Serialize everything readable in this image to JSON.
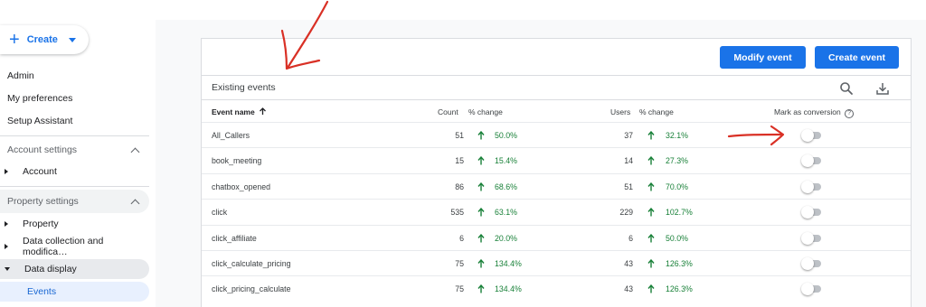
{
  "sidebar": {
    "create_label": "Create",
    "items": {
      "admin": "Admin",
      "preferences": "My preferences",
      "setup": "Setup Assistant",
      "account_settings": "Account settings",
      "account": "Account",
      "property_settings": "Property settings",
      "property": "Property",
      "data_collection": "Data collection and modifica…",
      "data_display": "Data display",
      "events": "Events"
    }
  },
  "toolbar": {
    "modify_event": "Modify event",
    "create_event": "Create event"
  },
  "card": {
    "title": "Existing events",
    "search_icon": "search-icon",
    "download_icon": "download-icon"
  },
  "table": {
    "headers": {
      "event_name": "Event name",
      "count": "Count",
      "count_change": "% change",
      "users": "Users",
      "users_change": "% change",
      "mark_conversion": "Mark as conversion"
    },
    "rows": [
      {
        "name": "All_Callers",
        "count": "51",
        "count_change": "50.0%",
        "users": "37",
        "users_change": "32.1%"
      },
      {
        "name": "book_meeting",
        "count": "15",
        "count_change": "15.4%",
        "users": "14",
        "users_change": "27.3%"
      },
      {
        "name": "chatbox_opened",
        "count": "86",
        "count_change": "68.6%",
        "users": "51",
        "users_change": "70.0%"
      },
      {
        "name": "click",
        "count": "535",
        "count_change": "63.1%",
        "users": "229",
        "users_change": "102.7%"
      },
      {
        "name": "click_affiliate",
        "count": "6",
        "count_change": "20.0%",
        "users": "6",
        "users_change": "50.0%"
      },
      {
        "name": "click_calculate_pricing",
        "count": "75",
        "count_change": "134.4%",
        "users": "43",
        "users_change": "126.3%"
      },
      {
        "name": "click_pricing_calculate",
        "count": "75",
        "count_change": "134.4%",
        "users": "43",
        "users_change": "126.3%"
      }
    ]
  },
  "colors": {
    "accent": "#1a73e8",
    "positive": "#188038",
    "annotation": "#d93025"
  }
}
